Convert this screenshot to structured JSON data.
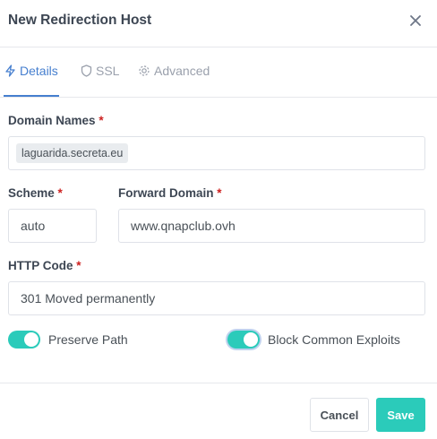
{
  "modal": {
    "title": "New Redirection Host"
  },
  "tabs": [
    {
      "label": "Details",
      "icon": "lightning-icon",
      "active": true
    },
    {
      "label": "SSL",
      "icon": "shield-icon",
      "active": false
    },
    {
      "label": "Advanced",
      "icon": "gear-icon",
      "active": false
    }
  ],
  "form": {
    "domain_names": {
      "label": "Domain Names",
      "required_mark": "*",
      "chips": [
        "laguarida.secreta.eu"
      ]
    },
    "scheme": {
      "label": "Scheme",
      "required_mark": "*",
      "value": "auto"
    },
    "forward_domain": {
      "label": "Forward Domain",
      "required_mark": "*",
      "value": "www.qnapclub.ovh"
    },
    "http_code": {
      "label": "HTTP Code",
      "required_mark": "*",
      "value": "301 Moved permanently"
    },
    "preserve_path": {
      "label": "Preserve Path",
      "checked": true
    },
    "block_exploits": {
      "label": "Block Common Exploits",
      "checked": true
    }
  },
  "buttons": {
    "cancel": "Cancel",
    "save": "Save"
  },
  "colors": {
    "accent": "#467fcf",
    "teal": "#2bcbba",
    "required": "#cd201f",
    "border": "#dfe2e8"
  }
}
